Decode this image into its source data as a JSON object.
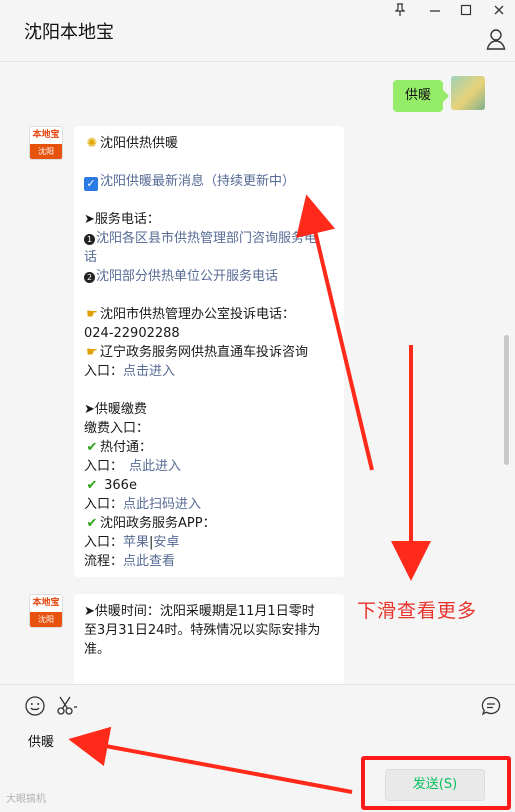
{
  "window": {
    "title": "沈阳本地宝",
    "controls": [
      "pin-icon",
      "minimize-icon",
      "maximize-icon",
      "close-icon"
    ]
  },
  "sent_message": {
    "text": "供暖"
  },
  "avatar": {
    "brand": "本地宝",
    "city": "沈阳"
  },
  "message1": {
    "title": "沈阳供热供暖",
    "latest_link": "沈阳供暖最新消息（持续更新中）",
    "phone_heading": "➤服务电话：",
    "phone_item1_line1": "沈阳各区县市供热管理部门咨询服务电",
    "phone_item1_line2": "话",
    "phone_item2": "沈阳部分供热单位公开服务电话",
    "complaint_line1": "沈阳市供热管理办公室投诉电话：",
    "complaint_phone": "024-22902288",
    "liaoning_line": "辽宁政务服务网供热直通车投诉咨询",
    "entry_label": "入口：",
    "entry_link1": "点击进入",
    "payment_heading": "➤供暖缴费",
    "payment_entry": "缴费入口：",
    "rerfutong": "热付通：",
    "entry_link2": "点此进入",
    "app366e": "366e",
    "entry_link3": "点此扫码进入",
    "gov_app": "沈阳政务服务APP：",
    "apple": "苹果",
    "separator": "|",
    "android": "安卓",
    "process_label": "流程：",
    "process_link": "点此查看"
  },
  "message2": {
    "line1": "➤供暖时间：沈阳采暖期是11月1日零时",
    "line2": "至3月31日24时。特殊情况以实际安排为",
    "line3": "准。"
  },
  "annotation": {
    "scroll_hint": "下滑查看更多"
  },
  "input": {
    "draft": "供暖",
    "send_label": "发送(S)",
    "tools": [
      "emoji-icon",
      "scissors-icon",
      "chat-history-icon"
    ]
  },
  "watermark": "大眼搞机",
  "colors": {
    "accent_green": "#07c160",
    "sent_bubble": "#95ec69",
    "link": "#576b95",
    "annotation_red": "#e8332a"
  }
}
